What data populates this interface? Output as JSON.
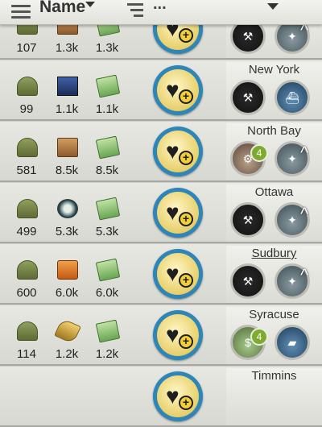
{
  "header": {
    "sort_label": "Name",
    "more_label": "...",
    "icons": [
      "menu-icon",
      "sort-icon",
      "dropdown-arrow-icon"
    ]
  },
  "rows": [
    {
      "city": "",
      "stats": [
        {
          "icon": "helmet-icon",
          "value": "107"
        },
        {
          "icon": "resource-icon",
          "value": "1.3k"
        },
        {
          "icon": "cash-icon",
          "value": "1.3k"
        }
      ],
      "units": [
        {
          "icon": "construction-icon"
        },
        {
          "icon": "artillery-icon"
        }
      ],
      "badge": ""
    },
    {
      "city": "New York",
      "stats": [
        {
          "icon": "helmet-icon",
          "value": "99"
        },
        {
          "icon": "steel-icon",
          "value": "1.1k"
        },
        {
          "icon": "cash-icon",
          "value": "1.1k"
        }
      ],
      "units": [
        {
          "icon": "construction-icon"
        },
        {
          "icon": "warship-icon"
        }
      ],
      "badge": ""
    },
    {
      "city": "North Bay",
      "stats": [
        {
          "icon": "helmet-icon",
          "value": "581"
        },
        {
          "icon": "crate-icon",
          "value": "8.5k"
        },
        {
          "icon": "cash-icon",
          "value": "8.5k"
        }
      ],
      "units": [
        {
          "icon": "railway-icon"
        },
        {
          "icon": "artillery-icon"
        }
      ],
      "badge": "4"
    },
    {
      "city": "Ottawa",
      "stats": [
        {
          "icon": "helmet-icon",
          "value": "499"
        },
        {
          "icon": "tire-icon",
          "value": "5.3k"
        },
        {
          "icon": "cash-icon",
          "value": "5.3k"
        }
      ],
      "units": [
        {
          "icon": "construction-icon"
        },
        {
          "icon": "artillery-icon"
        }
      ],
      "badge": ""
    },
    {
      "city": "Sudbury",
      "stats": [
        {
          "icon": "helmet-icon",
          "value": "600"
        },
        {
          "icon": "fuel-icon",
          "value": "6.0k"
        },
        {
          "icon": "cash-icon",
          "value": "6.0k"
        }
      ],
      "units": [
        {
          "icon": "construction-icon"
        },
        {
          "icon": "artillery-icon"
        }
      ],
      "badge": ""
    },
    {
      "city": "Syracuse",
      "stats": [
        {
          "icon": "helmet-icon",
          "value": "114"
        },
        {
          "icon": "grain-icon",
          "value": "1.2k"
        },
        {
          "icon": "cash-icon",
          "value": "1.2k"
        }
      ],
      "units": [
        {
          "icon": "money-icon"
        },
        {
          "icon": "tank-icon"
        }
      ],
      "badge": "4"
    },
    {
      "city": "Timmins",
      "stats": [],
      "units": [],
      "badge": ""
    }
  ],
  "colors": {
    "accent_blue": "#2e86b8",
    "gold": "#e7cf6a",
    "badge_green": "#7faa30",
    "row_bg": "#e4e4de"
  }
}
